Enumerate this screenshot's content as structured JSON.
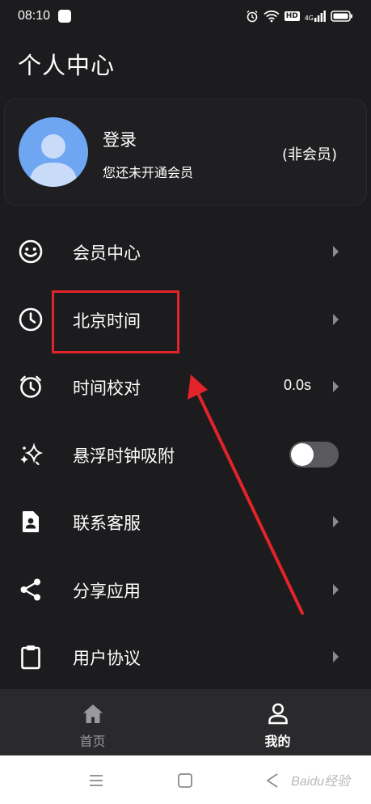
{
  "status_bar": {
    "time": "08:10",
    "network": "4G"
  },
  "page_title": "个人中心",
  "profile": {
    "login_label": "登录",
    "member_subtitle": "您还未开通会员",
    "member_status": "(非会员)"
  },
  "menu": {
    "items": [
      {
        "label": "会员中心",
        "icon": "smiley-icon"
      },
      {
        "label": "北京时间",
        "icon": "clock-icon"
      },
      {
        "label": "时间校对",
        "icon": "timer-icon",
        "value": "0.0s"
      },
      {
        "label": "悬浮时钟吸附",
        "icon": "sparkle-icon",
        "toggle_on": false
      },
      {
        "label": "联系客服",
        "icon": "contact-icon"
      },
      {
        "label": "分享应用",
        "icon": "share-icon"
      },
      {
        "label": "用户协议",
        "icon": "clipboard-icon"
      }
    ]
  },
  "tabs": [
    {
      "label": "首页",
      "icon": "home-icon",
      "active": false
    },
    {
      "label": "我的",
      "icon": "person-icon",
      "active": true
    }
  ],
  "watermark": "Baidu经验",
  "colors": {
    "background": "#1c1c1e",
    "tab_bar": "#2a2a2c",
    "annotation_red": "#e2232a",
    "avatar_blue": "#6fa6f2"
  }
}
